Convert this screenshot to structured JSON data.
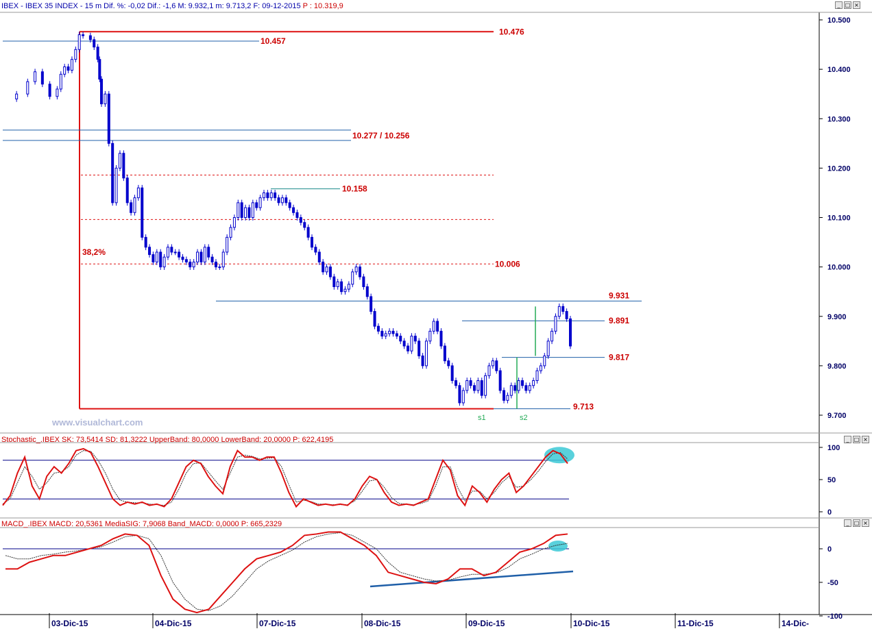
{
  "main_panel": {
    "header": {
      "symbol": "IBEX - IBEX 35 INDEX - 15 m",
      "dif_pct": "Dif. %: -0,02",
      "dif": "Dif.: -1,6",
      "max": "M: 9.932,1",
      "min": "m: 9.713,2",
      "date": "F: 09-12-2015",
      "price": "P : 10.319,9"
    },
    "watermark": "www.visualchart.com",
    "annotations": {
      "level_10476": "10.476",
      "level_10457": "10.457",
      "level_10277_10256": "10.277 / 10.256",
      "level_10158": "10.158",
      "level_10006": "10.006",
      "fib_38": "38,2%",
      "level_9931": "9.931",
      "level_9891": "9.891",
      "level_9817": "9.817",
      "level_9713": "9.713",
      "s1": "s1",
      "s2": "s2"
    }
  },
  "stoch_panel": {
    "header": "Stochastic_.IBEX SK: 73,5414  SD: 81,3222  UpperBand: 80,0000  LowerBand: 20,0000  P: 622,4195",
    "yticks": [
      "100",
      "50",
      "0"
    ]
  },
  "macd_panel": {
    "header": "MACD_.IBEX MACD: 20,5361  MediaSIG: 7,9068  Band_MACD: 0,0000  P: 665,2329",
    "yticks": [
      "0",
      "-50",
      "-100"
    ]
  },
  "window_buttons": [
    "_",
    "□",
    "×"
  ],
  "x_axis": [
    "03-Dic-15",
    "04-Dic-15",
    "07-Dic-15",
    "08-Dic-15",
    "09-Dic-15",
    "10-Dic-15",
    "11-Dic-15",
    "14-Dic-"
  ],
  "colors": {
    "candle": "#0000cc",
    "red_lines": "#dd1111",
    "blue_lines": "#1f5fa8",
    "green_marks": "#22aa55",
    "highlight": "#3cc9d6"
  },
  "chart_data": [
    {
      "type": "candlestick",
      "title": "IBEX - IBEX 35 INDEX - 15 m",
      "interval": "15 m",
      "ylim": [
        9680,
        10520
      ],
      "yticks": [
        "10.500",
        "10.400",
        "10.300",
        "10.200",
        "10.100",
        "10.000",
        "9.900",
        "9.800",
        "9.700"
      ],
      "ytick_values": [
        10500,
        10400,
        10300,
        10200,
        10100,
        10000,
        9900,
        9800,
        9700
      ],
      "x_labels": [
        "03-Dic-15",
        "04-Dic-15",
        "07-Dic-15",
        "08-Dic-15",
        "09-Dic-15",
        "10-Dic-15",
        "11-Dic-15",
        "14-Dic-"
      ],
      "close_path": [
        [
          0,
          10340
        ],
        [
          3,
          10350
        ],
        [
          6,
          10375
        ],
        [
          8,
          10395
        ],
        [
          10,
          10370
        ],
        [
          12,
          10345
        ],
        [
          14,
          10360
        ],
        [
          15,
          10390
        ],
        [
          16,
          10405
        ],
        [
          17,
          10398
        ],
        [
          18,
          10420
        ],
        [
          19,
          10440
        ],
        [
          20,
          10470
        ],
        [
          21,
          10468
        ],
        [
          23,
          10460
        ],
        [
          24,
          10445
        ],
        [
          25,
          10420
        ],
        [
          25.5,
          10380
        ],
        [
          26,
          10330
        ],
        [
          27,
          10350
        ],
        [
          28,
          10250
        ],
        [
          29,
          10130
        ],
        [
          30,
          10200
        ],
        [
          31,
          10230
        ],
        [
          32,
          10180
        ],
        [
          33,
          10130
        ],
        [
          34,
          10110
        ],
        [
          35,
          10140
        ],
        [
          36,
          10160
        ],
        [
          37,
          10060
        ],
        [
          38,
          10040
        ],
        [
          39,
          10025
        ],
        [
          40,
          10010
        ],
        [
          41,
          10030
        ],
        [
          42,
          10000
        ],
        [
          43,
          10020
        ],
        [
          44,
          10040
        ],
        [
          45,
          10030
        ],
        [
          46,
          10030
        ],
        [
          47,
          10020
        ],
        [
          48,
          10015
        ],
        [
          49,
          10010
        ],
        [
          50,
          10000
        ],
        [
          51,
          10010
        ],
        [
          52,
          10030
        ],
        [
          53,
          10010
        ],
        [
          54,
          10040
        ],
        [
          55,
          10020
        ],
        [
          56,
          10010
        ],
        [
          57,
          10000
        ],
        [
          58,
          10000
        ],
        [
          59,
          10030
        ],
        [
          60,
          10060
        ],
        [
          61,
          10080
        ],
        [
          62,
          10100
        ],
        [
          63,
          10130
        ],
        [
          64,
          10100
        ],
        [
          65,
          10120
        ],
        [
          66,
          10100
        ],
        [
          67,
          10130
        ],
        [
          68,
          10120
        ],
        [
          69,
          10140
        ],
        [
          70,
          10150
        ],
        [
          71,
          10140
        ],
        [
          72,
          10150
        ],
        [
          73,
          10140
        ],
        [
          74,
          10130
        ],
        [
          75,
          10140
        ],
        [
          76,
          10130
        ],
        [
          77,
          10120
        ],
        [
          78,
          10110
        ],
        [
          79,
          10100
        ],
        [
          80,
          10090
        ],
        [
          81,
          10080
        ],
        [
          82,
          10060
        ],
        [
          83,
          10040
        ],
        [
          84,
          10030
        ],
        [
          85,
          10010
        ],
        [
          86,
          9990
        ],
        [
          87,
          10000
        ],
        [
          88,
          9980
        ],
        [
          89,
          9960
        ],
        [
          90,
          9970
        ],
        [
          91,
          9950
        ],
        [
          92,
          9955
        ],
        [
          93,
          9965
        ],
        [
          94,
          9990
        ],
        [
          95,
          10000
        ],
        [
          96,
          9980
        ],
        [
          97,
          9960
        ],
        [
          98,
          9940
        ],
        [
          99,
          9910
        ],
        [
          100,
          9880
        ],
        [
          101,
          9870
        ],
        [
          102,
          9860
        ],
        [
          103,
          9865
        ],
        [
          104,
          9870
        ],
        [
          105,
          9865
        ],
        [
          106,
          9860
        ],
        [
          107,
          9850
        ],
        [
          108,
          9840
        ],
        [
          109,
          9830
        ],
        [
          110,
          9860
        ],
        [
          111,
          9850
        ],
        [
          112,
          9820
        ],
        [
          113,
          9800
        ],
        [
          114,
          9850
        ],
        [
          115,
          9870
        ],
        [
          116,
          9890
        ],
        [
          117,
          9870
        ],
        [
          118,
          9840
        ],
        [
          119,
          9810
        ],
        [
          120,
          9800
        ],
        [
          121,
          9770
        ],
        [
          122,
          9760
        ],
        [
          123,
          9725
        ],
        [
          124,
          9750
        ],
        [
          125,
          9770
        ],
        [
          126,
          9760
        ],
        [
          127,
          9750
        ],
        [
          128,
          9770
        ],
        [
          129,
          9740
        ],
        [
          130,
          9780
        ],
        [
          131,
          9800
        ],
        [
          132,
          9810
        ],
        [
          133,
          9790
        ],
        [
          134,
          9750
        ],
        [
          135,
          9730
        ],
        [
          136,
          9740
        ],
        [
          137,
          9760
        ],
        [
          138,
          9750
        ],
        [
          139,
          9770
        ],
        [
          140,
          9760
        ],
        [
          141,
          9750
        ],
        [
          142,
          9760
        ],
        [
          143,
          9770
        ],
        [
          144,
          9790
        ],
        [
          145,
          9800
        ],
        [
          146,
          9820
        ],
        [
          147,
          9850
        ],
        [
          148,
          9870
        ],
        [
          149,
          9900
        ],
        [
          150,
          9920
        ],
        [
          151,
          9910
        ],
        [
          152,
          9895
        ],
        [
          153,
          9840
        ]
      ],
      "bar_span": 153,
      "levels": [
        {
          "label": "10.476",
          "value": 10476,
          "style": "red-solid"
        },
        {
          "label": "10.457",
          "value": 10457,
          "style": "blue"
        },
        {
          "label": "10.277 / 10.256",
          "value": 10277,
          "value2": 10256,
          "style": "blue"
        },
        {
          "label": "10.158",
          "value": 10158,
          "style": "teal"
        },
        {
          "label": "10.006",
          "value": 10006,
          "style": "red-dotted"
        },
        {
          "label": "9.931",
          "value": 9931,
          "style": "blue"
        },
        {
          "label": "9.891",
          "value": 9891,
          "style": "blue"
        },
        {
          "label": "9.817",
          "value": 9817,
          "style": "blue"
        },
        {
          "label": "9.713",
          "value": 9713,
          "style": "blue"
        }
      ],
      "fib_dotted_levels": [
        10186,
        10096,
        10006
      ],
      "fib_label": "38,2%"
    },
    {
      "type": "line",
      "title": "Stochastic_.IBEX",
      "series": [
        {
          "name": "SK",
          "values": [
            10,
            25,
            60,
            85,
            40,
            20,
            55,
            70,
            60,
            75,
            95,
            98,
            92,
            70,
            45,
            20,
            10,
            15,
            12,
            15,
            10,
            12,
            8,
            20,
            45,
            70,
            80,
            75,
            55,
            40,
            28,
            70,
            95,
            85,
            85,
            80,
            85,
            85,
            60,
            30,
            8,
            20,
            15,
            10,
            12,
            10,
            12,
            10,
            20,
            40,
            55,
            50,
            30,
            15,
            10,
            12,
            10,
            15,
            20,
            50,
            80,
            65,
            25,
            10,
            40,
            30,
            15,
            35,
            50,
            60,
            30,
            40,
            55,
            70,
            85,
            95,
            90,
            75
          ]
        },
        {
          "name": "SD",
          "values": [
            12,
            20,
            45,
            70,
            55,
            35,
            45,
            60,
            62,
            70,
            88,
            95,
            94,
            80,
            60,
            35,
            18,
            15,
            14,
            14,
            12,
            11,
            10,
            15,
            35,
            60,
            75,
            76,
            62,
            48,
            35,
            60,
            85,
            88,
            86,
            82,
            83,
            84,
            70,
            42,
            15,
            18,
            16,
            12,
            12,
            11,
            11,
            11,
            17,
            32,
            48,
            50,
            38,
            22,
            13,
            12,
            11,
            13,
            17,
            40,
            70,
            70,
            38,
            17,
            32,
            32,
            20,
            30,
            45,
            55,
            38,
            40,
            50,
            63,
            78,
            90,
            92,
            82
          ]
        }
      ],
      "bands": [
        80,
        20
      ],
      "ylim": [
        -5,
        105
      ],
      "yticks": [
        "100",
        "50",
        "0"
      ]
    },
    {
      "type": "line",
      "title": "MACD_.IBEX",
      "series": [
        {
          "name": "MACD",
          "values": [
            -30,
            -30,
            -20,
            -15,
            -10,
            -10,
            -5,
            0,
            5,
            15,
            22,
            20,
            5,
            -40,
            -75,
            -90,
            -95,
            -90,
            -70,
            -50,
            -30,
            -15,
            -10,
            -5,
            5,
            20,
            22,
            25,
            25,
            15,
            5,
            -10,
            -35,
            -40,
            -45,
            -50,
            -52,
            -45,
            -30,
            -30,
            -40,
            -35,
            -20,
            -5,
            0,
            8,
            20,
            22
          ]
        },
        {
          "name": "MediaSIG",
          "values": [
            -10,
            -15,
            -15,
            -10,
            -8,
            -5,
            -3,
            0,
            3,
            10,
            18,
            20,
            15,
            -10,
            -50,
            -75,
            -90,
            -92,
            -85,
            -70,
            -50,
            -30,
            -18,
            -10,
            -2,
            10,
            18,
            22,
            24,
            20,
            10,
            0,
            -20,
            -35,
            -40,
            -45,
            -48,
            -47,
            -42,
            -38,
            -38,
            -36,
            -28,
            -15,
            -8,
            0,
            5,
            8
          ]
        }
      ],
      "zero_band": 0,
      "ylim": [
        -100,
        30
      ],
      "yticks": [
        "0",
        "-50",
        "-100"
      ]
    }
  ]
}
